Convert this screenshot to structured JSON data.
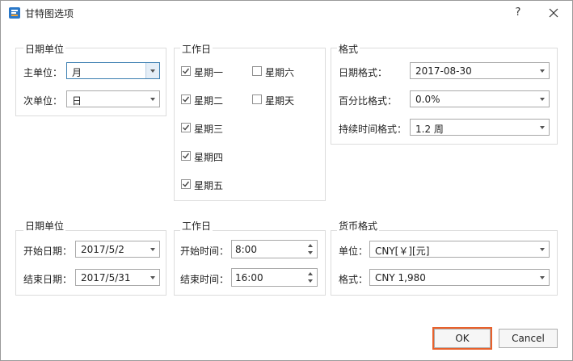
{
  "window": {
    "title": "甘特图选项",
    "help_label": "?"
  },
  "date_unit_group": {
    "legend": "日期单位",
    "main_unit_label": "主单位：",
    "main_unit_value": "月",
    "sub_unit_label": "次单位：",
    "sub_unit_value": "日"
  },
  "workday_group": {
    "legend": "工作日",
    "days": [
      {
        "label": "星期一",
        "checked": true
      },
      {
        "label": "星期二",
        "checked": true
      },
      {
        "label": "星期三",
        "checked": true
      },
      {
        "label": "星期四",
        "checked": true
      },
      {
        "label": "星期五",
        "checked": true
      },
      {
        "label": "星期六",
        "checked": false
      },
      {
        "label": "星期天",
        "checked": false
      }
    ]
  },
  "format_group": {
    "legend": "格式",
    "date_format_label": "日期格式：",
    "date_format_value": "2017-08-30",
    "percent_format_label": "百分比格式：",
    "percent_format_value": "0.0%",
    "duration_format_label": "持续时间格式：",
    "duration_format_value": "1.2 周"
  },
  "date_range_group": {
    "legend": "日期单位",
    "start_label": "开始日期：",
    "start_value": "2017/5/2",
    "end_label": "结束日期：",
    "end_value": "2017/5/31"
  },
  "work_time_group": {
    "legend": "工作日",
    "start_label": "开始时间：",
    "start_value": "8:00",
    "end_label": "结束时间：",
    "end_value": "16:00"
  },
  "currency_group": {
    "legend": "货币格式",
    "unit_label": "单位：",
    "unit_value": "CNY[￥][元]",
    "format_label": "格式：",
    "format_value": "CNY 1,980"
  },
  "buttons": {
    "ok_label": "OK",
    "cancel_label": "Cancel"
  },
  "colors": {
    "highlight": "#e8612c",
    "checkbox_accent": "#3c7fb1",
    "icon_blue": "#2b78c8"
  }
}
